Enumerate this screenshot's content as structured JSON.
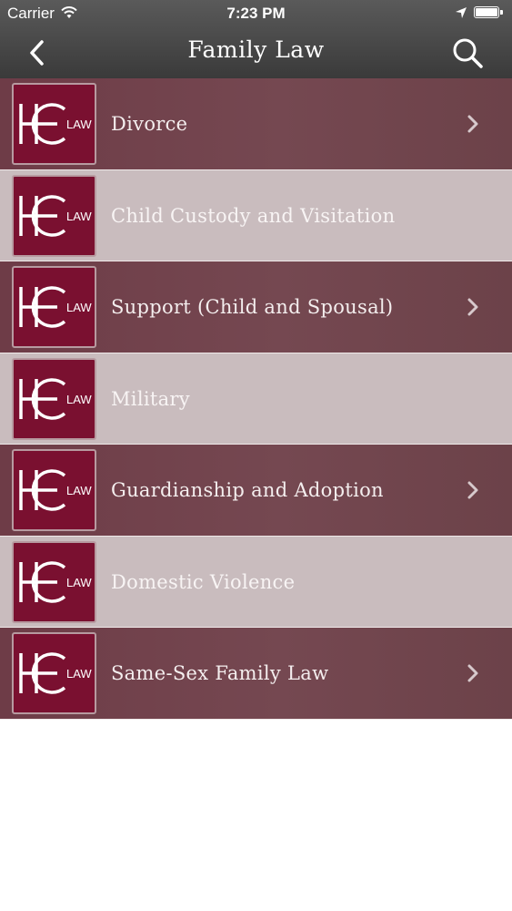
{
  "status_bar": {
    "carrier": "Carrier",
    "time": "7:23 PM"
  },
  "nav": {
    "title": "Family Law",
    "back_icon": "chevron-left-icon",
    "search_icon": "search-icon"
  },
  "logo_text": "LAW",
  "items": [
    {
      "label": "Divorce",
      "style": "dark",
      "chevron": true
    },
    {
      "label": "Child Custody and Visitation",
      "style": "light",
      "chevron": false
    },
    {
      "label": "Support (Child and Spousal)",
      "style": "dark",
      "chevron": true
    },
    {
      "label": "Military",
      "style": "light",
      "chevron": false
    },
    {
      "label": "Guardianship and Adoption",
      "style": "dark",
      "chevron": true
    },
    {
      "label": "Domestic Violence",
      "style": "light",
      "chevron": false
    },
    {
      "label": "Same-Sex Family Law",
      "style": "dark",
      "chevron": true
    }
  ],
  "colors": {
    "nav_bg": "#484848",
    "row_dark": "#714550",
    "row_light": "#c9bcbe",
    "logo_bg": "#7a1030"
  }
}
